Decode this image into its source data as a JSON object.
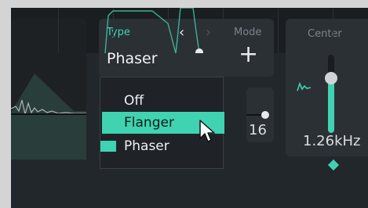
{
  "type_selector": {
    "label": "Type",
    "value": "Phaser",
    "prev_icon": "chevron-left-icon",
    "next_icon": "chevron-right-icon"
  },
  "mode": {
    "label": "Mode",
    "add_symbol": "+"
  },
  "center": {
    "label": "Center",
    "value": "1.26kHz",
    "slider_level_fraction": 0.7
  },
  "value_readout": "16",
  "dropdown": {
    "options": [
      {
        "label": "Off",
        "highlighted": false,
        "selected": false
      },
      {
        "label": "Flanger",
        "highlighted": true,
        "selected": false
      },
      {
        "label": "Phaser",
        "highlighted": false,
        "selected": true
      }
    ]
  },
  "colors": {
    "accent": "#3fd3b2",
    "background": "#22272b",
    "panel": "#2b3035",
    "text": "#f2f4f5",
    "muted": "#7c8389"
  }
}
